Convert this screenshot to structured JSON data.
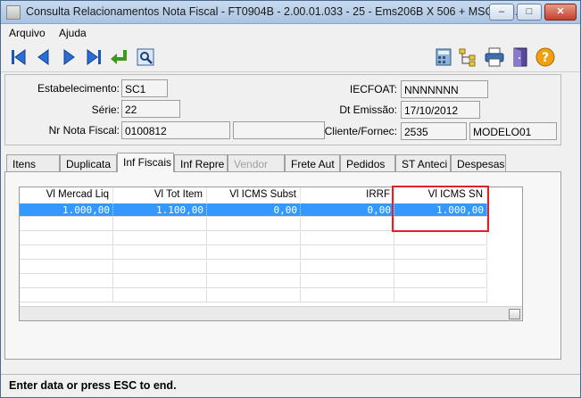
{
  "window": {
    "title": "Consulta Relacionamentos Nota Fiscal - FT0904B - 2.00.01.033 - 25 - Ems206B X 506 + MSC + M...",
    "buttons": {
      "minimize": "–",
      "maximize": "□",
      "close": "✕"
    }
  },
  "menu": {
    "items": [
      "Arquivo",
      "Ajuda"
    ]
  },
  "toolbar": {
    "left_icons": [
      "first-icon",
      "previous-icon",
      "next-icon",
      "last-icon",
      "return-icon",
      "zoom-search-icon"
    ],
    "right_icons": [
      "calculator-icon",
      "tree-icon",
      "printer-icon",
      "exit-door-icon",
      "help-icon"
    ]
  },
  "header": {
    "estabelecimento_label": "Estabelecimento:",
    "estabelecimento_value": "SC1",
    "serie_label": "Série:",
    "serie_value": "22",
    "nr_nota_label": "Nr Nota Fiscal:",
    "nr_nota_value": "0100812",
    "nr_nota_extra": "",
    "iecfoat_label": "IECFOAT:",
    "iecfoat_value": "NNNNNNN",
    "dt_emissao_label": "Dt Emissão:",
    "dt_emissao_value": "17/10/2012",
    "cliente_label": "Cliente/Fornec:",
    "cliente_code": "2535",
    "cliente_name": "MODELO01"
  },
  "tabs": [
    {
      "label": "Itens",
      "state": "normal"
    },
    {
      "label": "Duplicata",
      "state": "normal"
    },
    {
      "label": "Inf Fiscais",
      "state": "active"
    },
    {
      "label": "Inf Repre",
      "state": "normal"
    },
    {
      "label": "Vendor",
      "state": "disabled"
    },
    {
      "label": "Frete Aut",
      "state": "normal"
    },
    {
      "label": "Pedidos",
      "state": "normal"
    },
    {
      "label": "ST Anteci",
      "state": "normal"
    },
    {
      "label": "Despesas",
      "state": "normal"
    }
  ],
  "grid": {
    "columns": [
      "Vl Mercad Liq",
      "Vl Tot Item",
      "Vl ICMS Subst",
      "IRRF",
      "Vl ICMS SN"
    ],
    "rows": [
      [
        "1.000,00",
        "1.100,00",
        "0,00",
        "0,00",
        "1.000,00"
      ]
    ]
  },
  "status": {
    "text": "Enter data or press ESC to end."
  }
}
